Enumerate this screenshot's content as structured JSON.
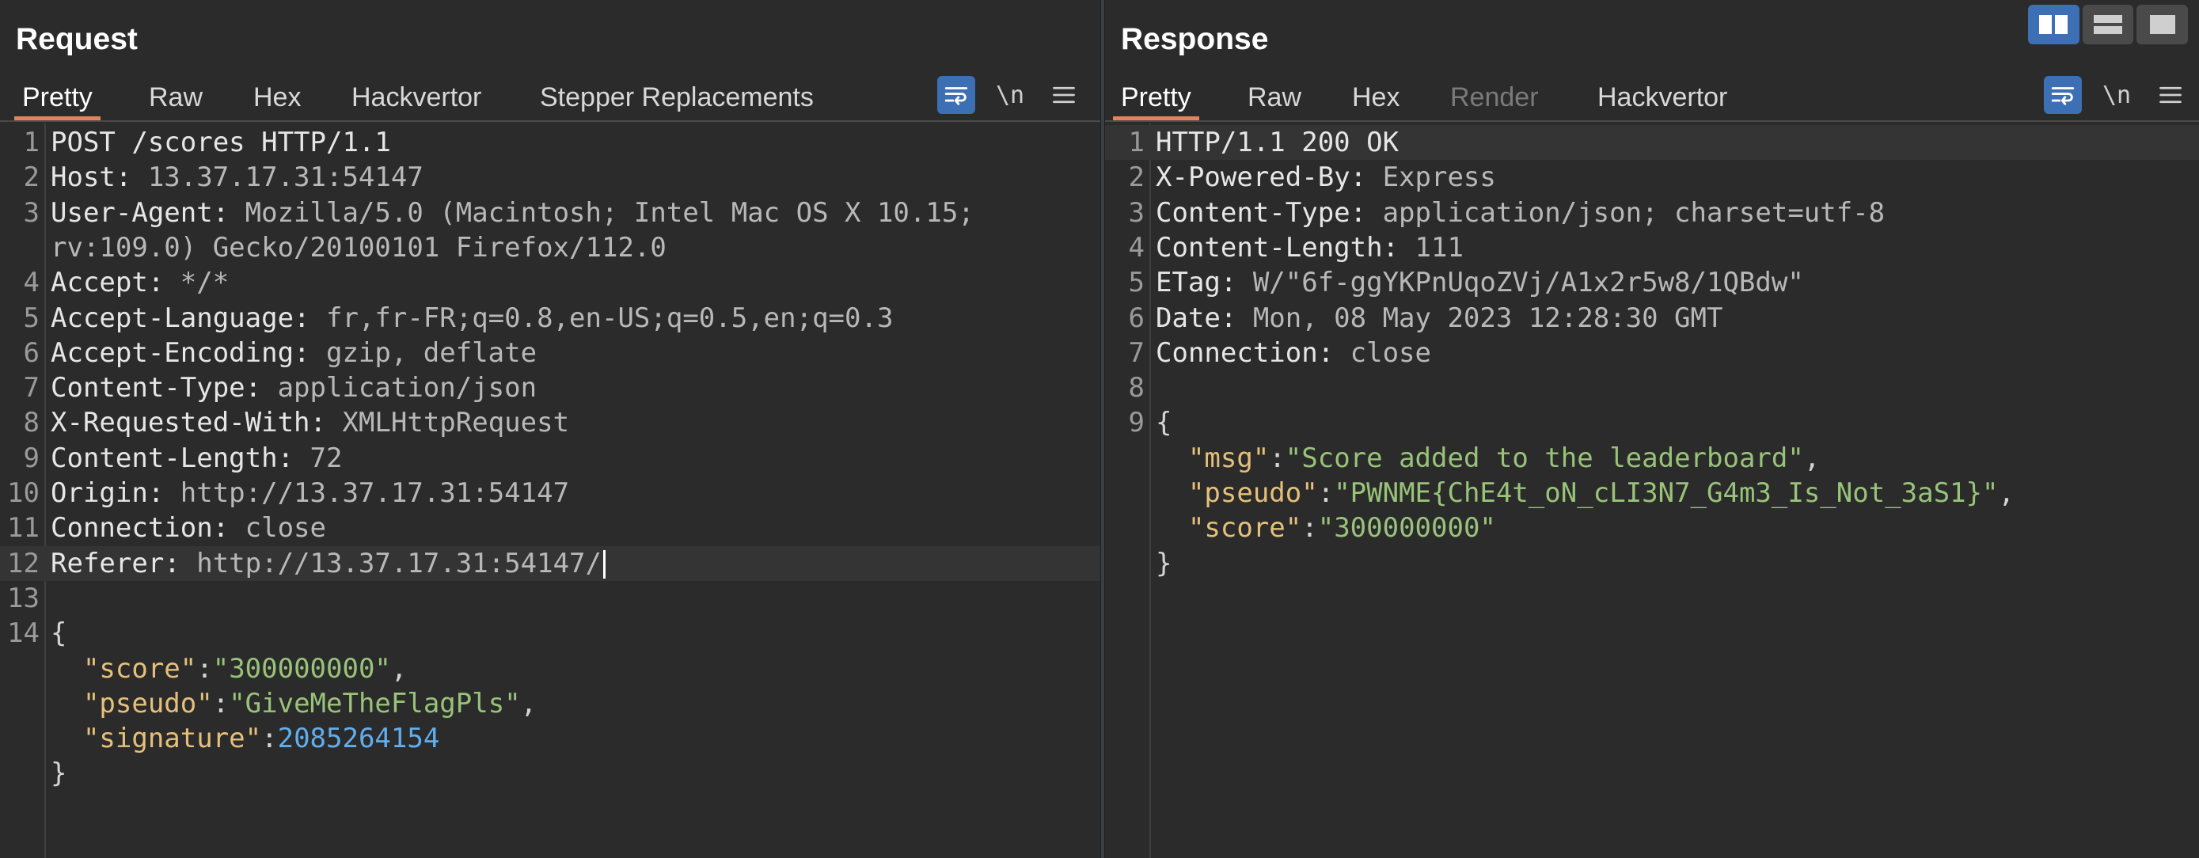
{
  "request": {
    "title": "Request",
    "tabs": [
      {
        "label": "Pretty",
        "active": true
      },
      {
        "label": "Raw"
      },
      {
        "label": "Hex"
      },
      {
        "label": "Hackvertor"
      },
      {
        "label": "Stepper Replacements"
      }
    ],
    "newline_label": "\\n",
    "lines": [
      {
        "n": "1",
        "parts": [
          {
            "t": "plain",
            "v": "POST /scores HTTP/1.1"
          }
        ]
      },
      {
        "n": "2",
        "parts": [
          {
            "t": "hname",
            "v": "Host:"
          },
          {
            "t": "hval",
            "v": " 13.37.17.31:54147"
          }
        ]
      },
      {
        "n": "3",
        "parts": [
          {
            "t": "hname",
            "v": "User-Agent:"
          },
          {
            "t": "hval",
            "v": " Mozilla/5.0 (Macintosh; Intel Mac OS X 10.15;"
          }
        ]
      },
      {
        "n": "",
        "parts": [
          {
            "t": "hval",
            "v": "rv:109.0) Gecko/20100101 Firefox/112.0"
          }
        ]
      },
      {
        "n": "4",
        "parts": [
          {
            "t": "hname",
            "v": "Accept:"
          },
          {
            "t": "hval",
            "v": " */*"
          }
        ]
      },
      {
        "n": "5",
        "parts": [
          {
            "t": "hname",
            "v": "Accept-Language:"
          },
          {
            "t": "hval",
            "v": " fr,fr-FR;q=0.8,en-US;q=0.5,en;q=0.3"
          }
        ]
      },
      {
        "n": "6",
        "parts": [
          {
            "t": "hname",
            "v": "Accept-Encoding:"
          },
          {
            "t": "hval",
            "v": " gzip, deflate"
          }
        ]
      },
      {
        "n": "7",
        "parts": [
          {
            "t": "hname",
            "v": "Content-Type:"
          },
          {
            "t": "hval",
            "v": " application/json"
          }
        ]
      },
      {
        "n": "8",
        "parts": [
          {
            "t": "hname",
            "v": "X-Requested-With:"
          },
          {
            "t": "hval",
            "v": " XMLHttpRequest"
          }
        ]
      },
      {
        "n": "9",
        "parts": [
          {
            "t": "hname",
            "v": "Content-Length:"
          },
          {
            "t": "hval",
            "v": " 72"
          }
        ]
      },
      {
        "n": "10",
        "parts": [
          {
            "t": "hname",
            "v": "Origin:"
          },
          {
            "t": "hval",
            "v": " http://13.37.17.31:54147"
          }
        ]
      },
      {
        "n": "11",
        "parts": [
          {
            "t": "hname",
            "v": "Connection:"
          },
          {
            "t": "hval",
            "v": " close"
          }
        ]
      },
      {
        "n": "12",
        "highlight": true,
        "caret": true,
        "parts": [
          {
            "t": "hname",
            "v": "Referer:"
          },
          {
            "t": "hval",
            "v": " http://13.37.17.31:54147/"
          }
        ]
      },
      {
        "n": "13",
        "parts": []
      },
      {
        "n": "14",
        "parts": [
          {
            "t": "punct",
            "v": "{"
          }
        ]
      },
      {
        "n": "",
        "parts": [
          {
            "t": "plain",
            "v": "  "
          },
          {
            "t": "jkey",
            "v": "\"score\""
          },
          {
            "t": "punct",
            "v": ":"
          },
          {
            "t": "jstr",
            "v": "\"300000000\""
          },
          {
            "t": "punct",
            "v": ","
          }
        ]
      },
      {
        "n": "",
        "parts": [
          {
            "t": "plain",
            "v": "  "
          },
          {
            "t": "jkey",
            "v": "\"pseudo\""
          },
          {
            "t": "punct",
            "v": ":"
          },
          {
            "t": "jstr",
            "v": "\"GiveMeTheFlagPls\""
          },
          {
            "t": "punct",
            "v": ","
          }
        ]
      },
      {
        "n": "",
        "parts": [
          {
            "t": "plain",
            "v": "  "
          },
          {
            "t": "jkey",
            "v": "\"signature\""
          },
          {
            "t": "punct",
            "v": ":"
          },
          {
            "t": "jnum",
            "v": "2085264154"
          }
        ]
      },
      {
        "n": "",
        "parts": [
          {
            "t": "punct",
            "v": "}"
          }
        ]
      }
    ]
  },
  "response": {
    "title": "Response",
    "tabs": [
      {
        "label": "Pretty",
        "active": true
      },
      {
        "label": "Raw"
      },
      {
        "label": "Hex"
      },
      {
        "label": "Render",
        "disabled": true
      },
      {
        "label": "Hackvertor"
      }
    ],
    "newline_label": "\\n",
    "lines": [
      {
        "n": "1",
        "highlight": true,
        "parts": [
          {
            "t": "plain",
            "v": "HTTP/1.1 200 OK"
          }
        ]
      },
      {
        "n": "2",
        "parts": [
          {
            "t": "hname",
            "v": "X-Powered-By:"
          },
          {
            "t": "hval",
            "v": " Express"
          }
        ]
      },
      {
        "n": "3",
        "parts": [
          {
            "t": "hname",
            "v": "Content-Type:"
          },
          {
            "t": "hval",
            "v": " application/json; charset=utf-8"
          }
        ]
      },
      {
        "n": "4",
        "parts": [
          {
            "t": "hname",
            "v": "Content-Length:"
          },
          {
            "t": "hval",
            "v": " 111"
          }
        ]
      },
      {
        "n": "5",
        "parts": [
          {
            "t": "hname",
            "v": "ETag:"
          },
          {
            "t": "hval",
            "v": " W/\"6f-ggYKPnUqoZVj/A1x2r5w8/1QBdw\""
          }
        ]
      },
      {
        "n": "6",
        "parts": [
          {
            "t": "hname",
            "v": "Date:"
          },
          {
            "t": "hval",
            "v": " Mon, 08 May 2023 12:28:30 GMT"
          }
        ]
      },
      {
        "n": "7",
        "parts": [
          {
            "t": "hname",
            "v": "Connection:"
          },
          {
            "t": "hval",
            "v": " close"
          }
        ]
      },
      {
        "n": "8",
        "parts": []
      },
      {
        "n": "9",
        "parts": [
          {
            "t": "punct",
            "v": "{"
          }
        ]
      },
      {
        "n": "",
        "parts": [
          {
            "t": "plain",
            "v": "  "
          },
          {
            "t": "jkey",
            "v": "\"msg\""
          },
          {
            "t": "punct",
            "v": ":"
          },
          {
            "t": "jstr",
            "v": "\"Score added to the leaderboard\""
          },
          {
            "t": "punct",
            "v": ","
          }
        ]
      },
      {
        "n": "",
        "parts": [
          {
            "t": "plain",
            "v": "  "
          },
          {
            "t": "jkey",
            "v": "\"pseudo\""
          },
          {
            "t": "punct",
            "v": ":"
          },
          {
            "t": "jstr",
            "v": "\"PWNME{ChE4t_oN_cLI3N7_G4m3_Is_Not_3aS1}\""
          },
          {
            "t": "punct",
            "v": ","
          }
        ]
      },
      {
        "n": "",
        "parts": [
          {
            "t": "plain",
            "v": "  "
          },
          {
            "t": "jkey",
            "v": "\"score\""
          },
          {
            "t": "punct",
            "v": ":"
          },
          {
            "t": "jstr",
            "v": "\"300000000\""
          }
        ]
      },
      {
        "n": "",
        "parts": [
          {
            "t": "punct",
            "v": "}"
          }
        ]
      }
    ]
  },
  "layout_buttons": [
    {
      "icon": "split-vertical-icon",
      "active": true
    },
    {
      "icon": "split-horizontal-icon"
    },
    {
      "icon": "single-pane-icon"
    }
  ],
  "colors": {
    "accent": "#e8825a",
    "toggle_blue": "#3d6fb4",
    "json_key": "#e6c07b",
    "json_string": "#98c379",
    "json_number": "#61aeee"
  }
}
